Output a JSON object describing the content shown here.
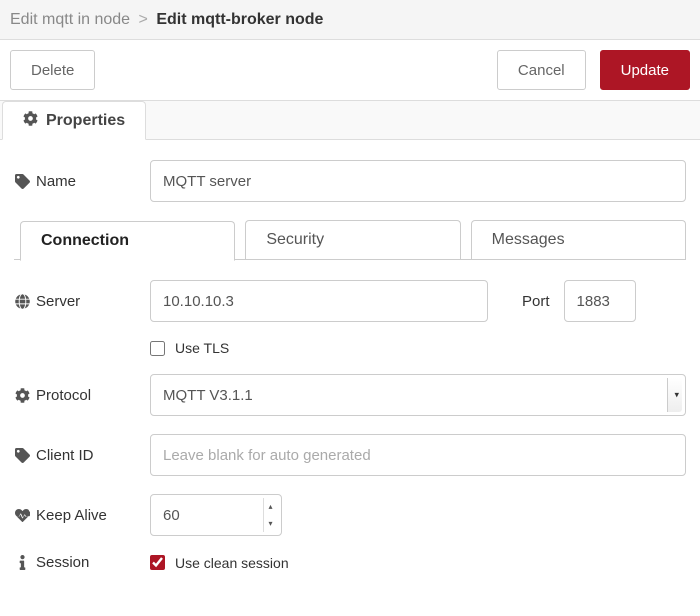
{
  "breadcrumb": {
    "prev": "Edit mqtt in node",
    "current": "Edit mqtt-broker node"
  },
  "actions": {
    "delete": "Delete",
    "cancel": "Cancel",
    "update": "Update"
  },
  "mainTab": {
    "properties": "Properties"
  },
  "fields": {
    "name": {
      "label": "Name",
      "value": "MQTT server"
    },
    "server": {
      "label": "Server",
      "value": "10.10.10.3"
    },
    "port": {
      "label": "Port",
      "value": "1883"
    },
    "tls": {
      "label": "Use TLS",
      "checked": false
    },
    "protocol": {
      "label": "Protocol",
      "value": "MQTT V3.1.1"
    },
    "clientId": {
      "label": "Client ID",
      "value": "",
      "placeholder": "Leave blank for auto generated"
    },
    "keepAlive": {
      "label": "Keep Alive",
      "value": "60"
    },
    "session": {
      "label": "Session",
      "checkboxLabel": "Use clean session",
      "checked": true
    }
  },
  "innerTabs": {
    "connection": "Connection",
    "security": "Security",
    "messages": "Messages"
  }
}
